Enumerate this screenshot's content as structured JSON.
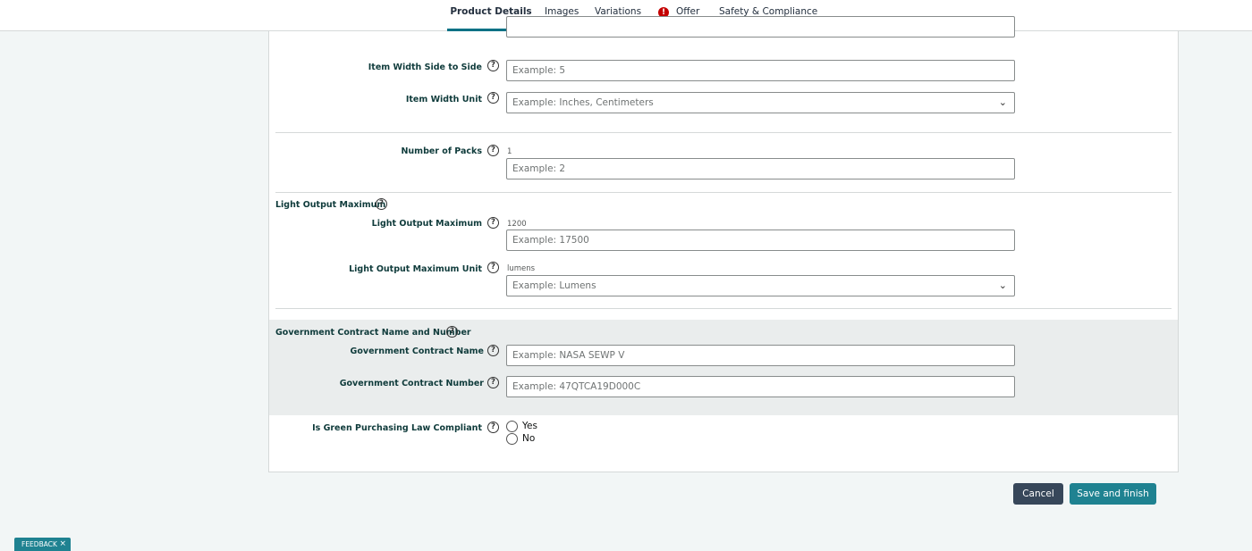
{
  "tabs": [
    {
      "label": "Product Details",
      "active": true
    },
    {
      "label": "Images"
    },
    {
      "label": "Variations"
    },
    {
      "label": "Offer",
      "alert": "!"
    },
    {
      "label": "Safety & Compliance"
    }
  ],
  "help_glyph": "?",
  "fields": {
    "prev_input_value": "",
    "item_width": {
      "label": "Item Width Side to Side",
      "placeholder": "Example: 5"
    },
    "item_width_unit": {
      "label": "Item Width Unit",
      "placeholder": "Example: Inches, Centimeters"
    },
    "number_of_packs": {
      "label": "Number of Packs",
      "current": "1",
      "placeholder": "Example: 2"
    },
    "light_output_group": {
      "title": "Light Output Maximum"
    },
    "light_output_max": {
      "label": "Light Output Maximum",
      "current": "1200",
      "placeholder": "Example: 17500"
    },
    "light_output_unit": {
      "label": "Light Output Maximum Unit",
      "current": "lumens",
      "placeholder": "Example: Lumens"
    },
    "gov_contract_group": {
      "title": "Government Contract Name and Number"
    },
    "gov_contract_name": {
      "label": "Government Contract Name",
      "placeholder": "Example: NASA SEWP V"
    },
    "gov_contract_number": {
      "label": "Government Contract Number",
      "placeholder": "Example: 47QTCA19D000C"
    },
    "green_purchasing": {
      "label": "Is Green Purchasing Law Compliant",
      "options": [
        "Yes",
        "No"
      ]
    }
  },
  "chevron": "⌄",
  "buttons": {
    "cancel": "Cancel",
    "save": "Save and finish"
  },
  "feedback": {
    "label": "FEEDBACK",
    "close": "×"
  },
  "colors": {
    "accent": "#007185",
    "alert": "#c40000",
    "primary_button": "#1f8291",
    "cancel_button": "#37475a"
  }
}
